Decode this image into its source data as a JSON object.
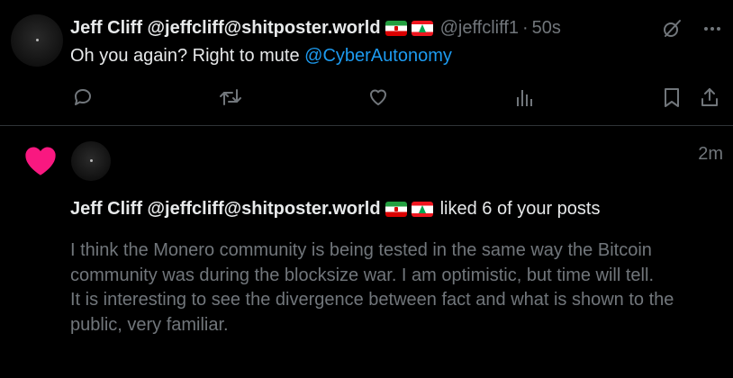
{
  "post": {
    "author_name": "Jeff Cliff @jeffcliff@shitposter.world",
    "handle": "@jeffcliff1",
    "separator": "·",
    "time": "50s",
    "text": "Oh you again?  Right to mute ",
    "mention": "@CyberAutonomy"
  },
  "notification": {
    "time": "2m",
    "author_name": "Jeff Cliff @jeffcliff@shitposter.world",
    "action_text": "liked 6 of your posts",
    "body_lines": [
      "I think the Monero community is being tested in the same way the Bitcoin community was during the blocksize war. I am optimistic, but time will tell.",
      "It is interesting to see the divergence between fact and what is shown to the public, very familiar."
    ]
  },
  "colors": {
    "background": "#000000",
    "text": "#e7e9ea",
    "muted": "#71767b",
    "link": "#1d9bf0",
    "like_heart": "#f91880",
    "divider": "#2f3336"
  },
  "icons": [
    "grok-icon",
    "more-icon",
    "reply-icon",
    "repost-icon",
    "like-icon",
    "views-icon",
    "bookmark-icon",
    "share-icon",
    "heart-icon"
  ]
}
